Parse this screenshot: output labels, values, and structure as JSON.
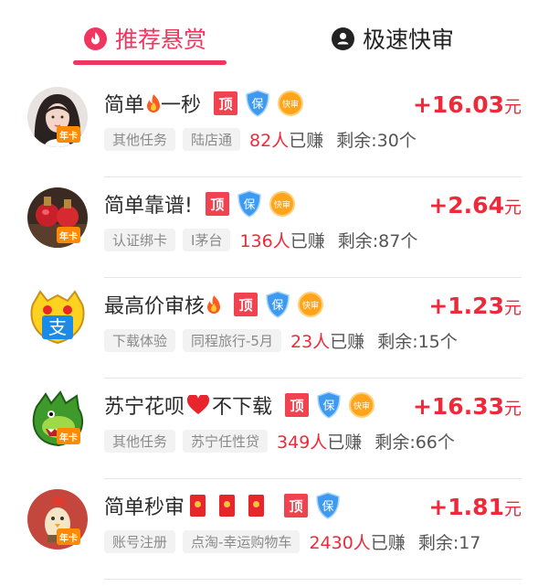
{
  "tabs": [
    {
      "label": "推荐悬赏",
      "icon": "fire-icon",
      "active": true
    },
    {
      "label": "极速快审",
      "icon": "user-icon",
      "active": false
    }
  ],
  "badges": {
    "top": "顶",
    "bao": "保",
    "kuai": "快审",
    "avatar_badge": "年卡"
  },
  "colors": {
    "accent": "#f0365f",
    "price": "#ee2a3a",
    "top_badge": "#f0424f",
    "bao_badge": "#3d9aef",
    "kuai_badge": "#ffa41b"
  },
  "tasks": [
    {
      "title": "简单",
      "title_suffix": "一秒",
      "title_emoji": "fire",
      "tags": [
        "其他任务",
        "陆店通"
      ],
      "earned_count": "82人",
      "earned_suffix": "已赚",
      "remain": "剩余:30个",
      "price": "+16.03",
      "unit": "元",
      "badges": [
        "top",
        "bao",
        "kuai"
      ]
    },
    {
      "title": "简单靠谱!",
      "tags": [
        "认证绑卡",
        "I茅台"
      ],
      "earned_count": "136人",
      "earned_suffix": "已赚",
      "remain": "剩余:87个",
      "price": "+2.64",
      "unit": "元",
      "badges": [
        "top",
        "bao",
        "kuai"
      ]
    },
    {
      "title": "最高价审核",
      "title_emoji": "fire",
      "tags": [
        "下载体验",
        "同程旅行-5月"
      ],
      "earned_count": "23人",
      "earned_suffix": "已赚",
      "remain": "剩余:15个",
      "price": "+1.23",
      "unit": "元",
      "badges": [
        "top",
        "bao",
        "kuai"
      ]
    },
    {
      "title": "苏宁花呗",
      "title_suffix": "不下载",
      "title_emoji": "heart",
      "tags": [
        "其他任务",
        "苏宁任性贷"
      ],
      "earned_count": "349人",
      "earned_suffix": "已赚",
      "remain": "剩余:66个",
      "price": "+16.33",
      "unit": "元",
      "badges": [
        "top",
        "bao",
        "kuai"
      ]
    },
    {
      "title": "简单秒审",
      "title_emoji": "hongbao",
      "tags": [
        "账号注册",
        "点淘-幸运购物车"
      ],
      "earned_count": "2430人",
      "earned_suffix": "已赚",
      "remain": "剩余:17",
      "price": "+1.81",
      "unit": "元",
      "badges": [
        "top",
        "bao"
      ]
    }
  ]
}
